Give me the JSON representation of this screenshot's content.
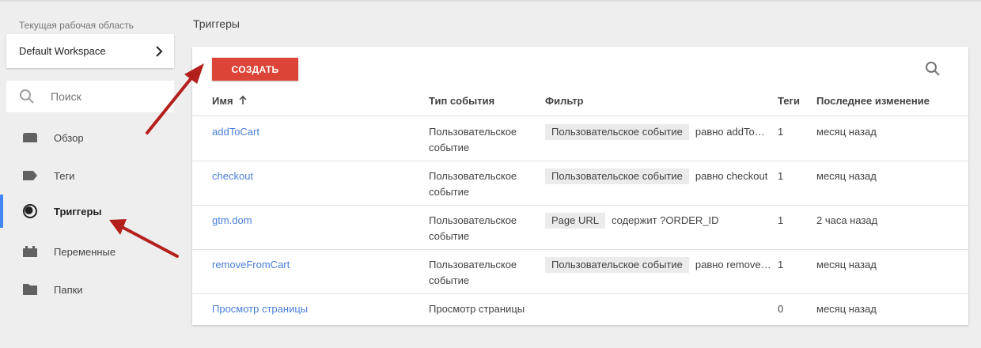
{
  "sidebar": {
    "workspace_label": "Текущая рабочая область",
    "workspace_name": "Default Workspace",
    "search_placeholder": "Поиск",
    "items": [
      {
        "label": "Обзор",
        "icon": "overview-icon"
      },
      {
        "label": "Теги",
        "icon": "tag-icon"
      },
      {
        "label": "Триггеры",
        "icon": "trigger-icon",
        "active": true
      },
      {
        "label": "Переменные",
        "icon": "variables-icon"
      },
      {
        "label": "Папки",
        "icon": "folder-icon"
      }
    ]
  },
  "main": {
    "title": "Триггеры",
    "create_button": "СОЗДАТЬ",
    "columns": {
      "name": "Имя",
      "event_type": "Тип события",
      "filter": "Фильтр",
      "tags": "Теги",
      "modified": "Последнее изменение"
    },
    "rows": [
      {
        "name": "addToCart",
        "type_line1": "Пользовательское",
        "type_line2": "событие",
        "filter_chip": "Пользовательское событие",
        "filter_value": "равно addToCart",
        "tags": "1",
        "modified": "месяц назад"
      },
      {
        "name": "checkout",
        "type_line1": "Пользовательское",
        "type_line2": "событие",
        "filter_chip": "Пользовательское событие",
        "filter_value": "равно checkout",
        "tags": "1",
        "modified": "месяц назад"
      },
      {
        "name": "gtm.dom",
        "type_line1": "Пользовательское",
        "type_line2": "событие",
        "filter_chip": "Page URL",
        "filter_value": "содержит ?ORDER_ID",
        "tags": "1",
        "modified": "2 часа назад"
      },
      {
        "name": "removeFromCart",
        "type_line1": "Пользовательское",
        "type_line2": "событие",
        "filter_chip": "Пользовательское событие",
        "filter_value": "равно removeFromCart",
        "tags": "1",
        "modified": "месяц назад"
      },
      {
        "name": "Просмотр страницы",
        "type_line1": "Просмотр страницы",
        "type_line2": "",
        "filter_chip": "",
        "filter_value": "",
        "tags": "0",
        "modified": "месяц назад"
      }
    ]
  },
  "colors": {
    "accent_blue": "#4285f4",
    "create_red": "#db4437",
    "link_blue": "#4a7fd8",
    "annotation_arrow": "#b3201c"
  }
}
